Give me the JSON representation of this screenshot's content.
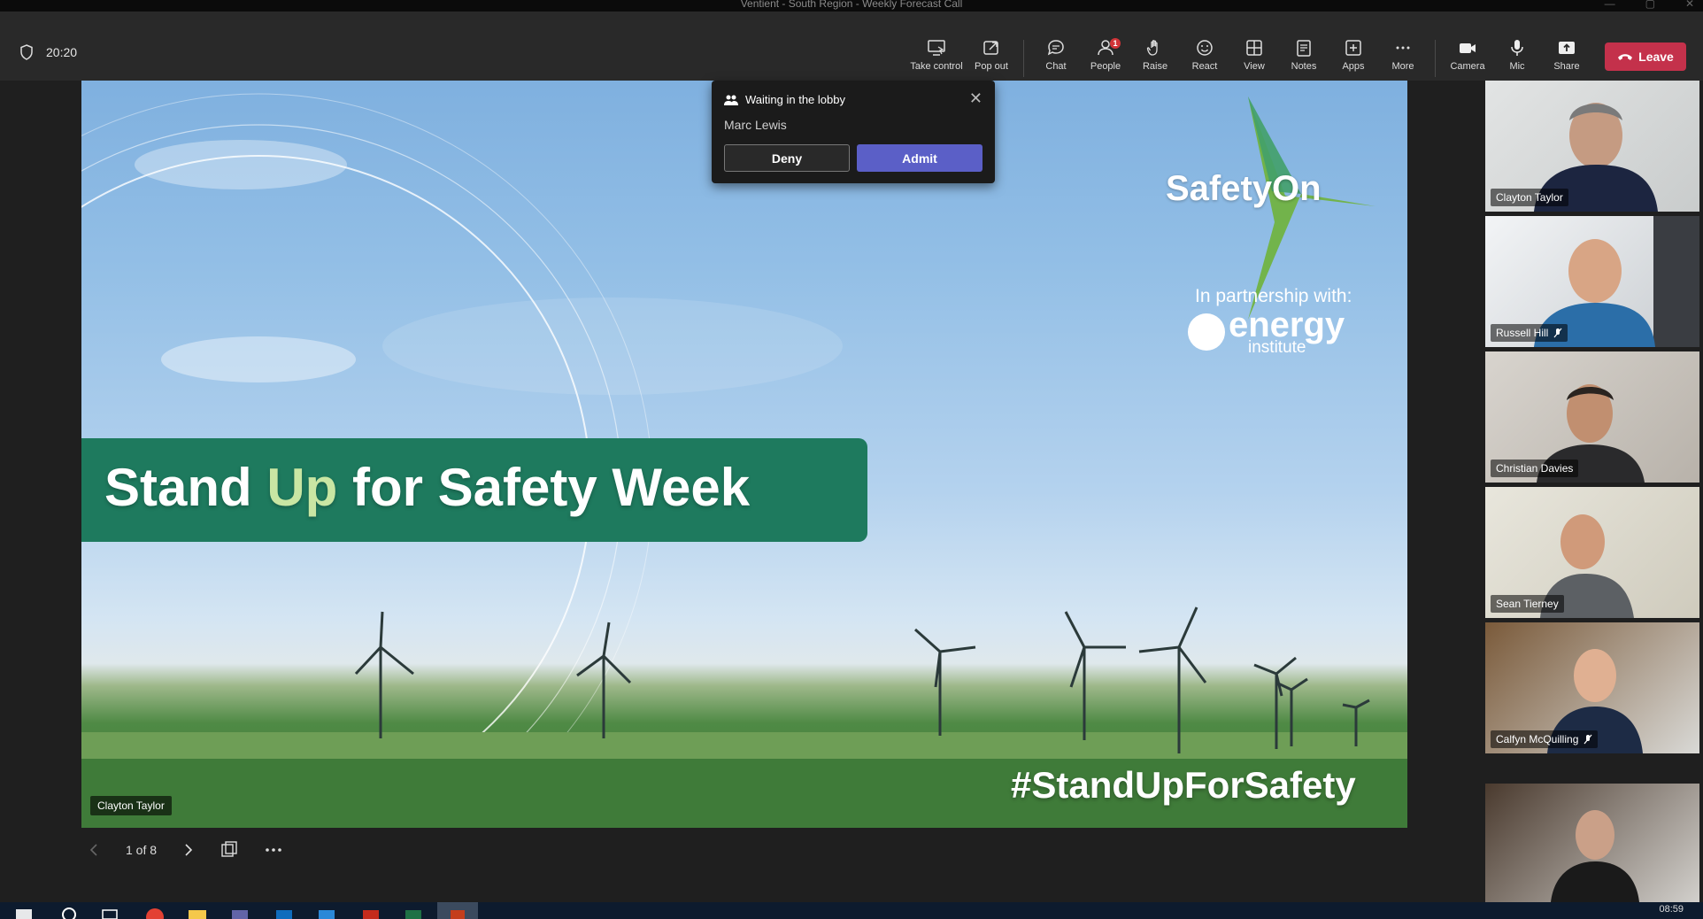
{
  "window": {
    "title": "Ventient - South Region - Weekly Forecast Call"
  },
  "meeting": {
    "timer": "20:20"
  },
  "toolbar": {
    "take_control": "Take control",
    "pop_out": "Pop out",
    "chat": "Chat",
    "people": "People",
    "people_badge": "1",
    "raise": "Raise",
    "react": "React",
    "view": "View",
    "notes": "Notes",
    "apps": "Apps",
    "more": "More",
    "camera": "Camera",
    "mic": "Mic",
    "share": "Share",
    "leave": "Leave"
  },
  "lobby": {
    "header": "Waiting in the lobby",
    "person": "Marc Lewis",
    "deny": "Deny",
    "admit": "Admit"
  },
  "slide": {
    "brand": "SafetyOn",
    "partnership": "In partnership with:",
    "partner_logo_text": "energy",
    "partner_logo_sub": "institute",
    "headline_part1": "Stand ",
    "headline_part2": "Up",
    "headline_part3": " for Safety Week",
    "hashtag": "#StandUpForSafety",
    "presenter": "Clayton Taylor"
  },
  "slide_controls": {
    "page": "1 of 8"
  },
  "participants": [
    {
      "name": "Clayton Taylor",
      "muted": false
    },
    {
      "name": "Russell Hill",
      "muted": true
    },
    {
      "name": "Christian Davies",
      "muted": false
    },
    {
      "name": "Sean Tierney",
      "muted": false
    },
    {
      "name": "Calfyn McQuilling",
      "muted": true
    },
    {
      "name": "",
      "muted": false
    }
  ],
  "taskbar": {
    "time": "08:59"
  },
  "colors": {
    "leave": "#c4314b",
    "admit": "#5b5fc7",
    "banner": "#1e7a5e",
    "brand_green": "#6fb33a"
  }
}
